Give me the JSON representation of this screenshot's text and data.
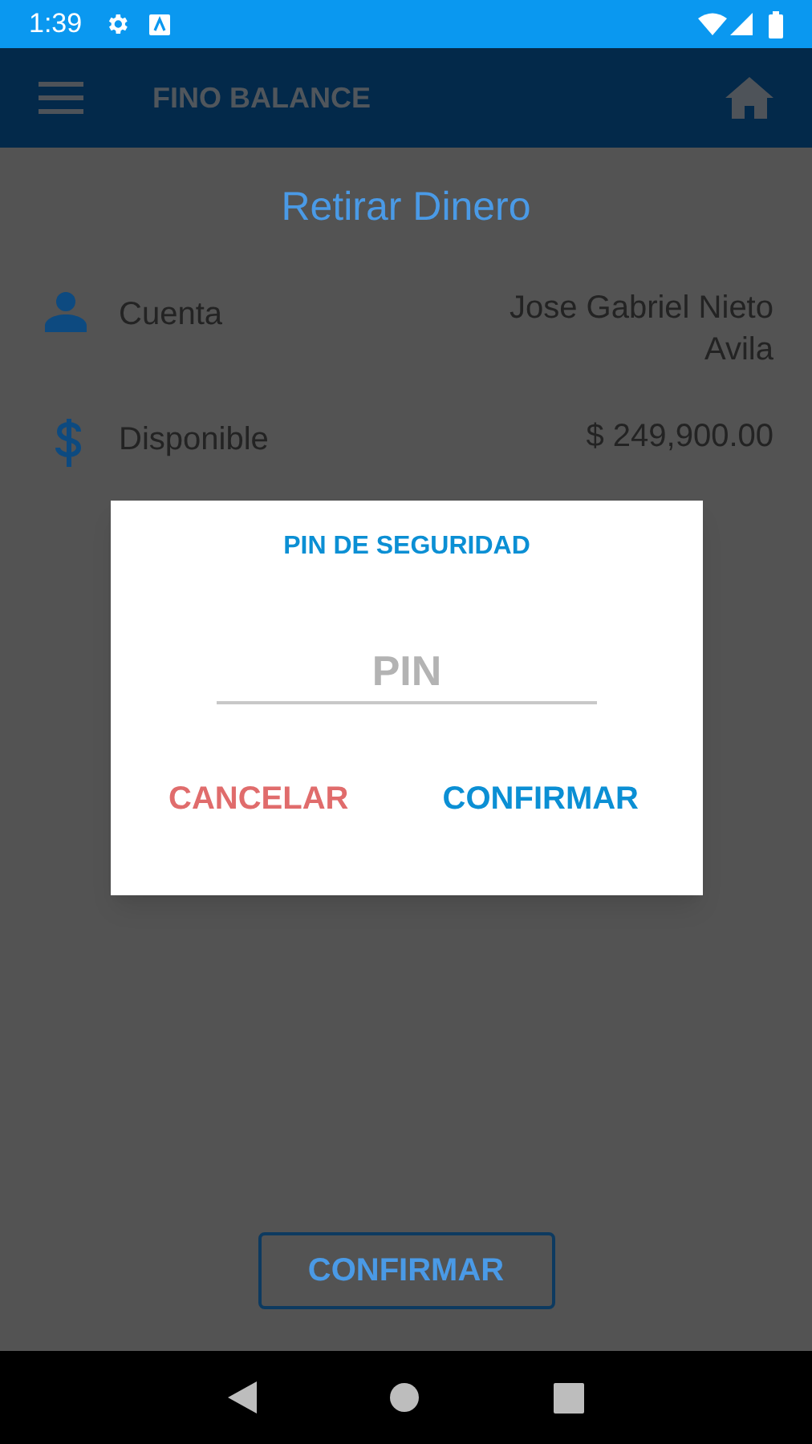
{
  "status_bar": {
    "time": "1:39"
  },
  "app_bar": {
    "title": "FINO BALANCE"
  },
  "page_title": "Retirar Dinero",
  "fields": [
    {
      "kind": "account",
      "label": "Cuenta",
      "value": "Jose Gabriel Nieto Avila"
    },
    {
      "kind": "balance",
      "label": "Disponible",
      "value": "$ 249,900.00"
    }
  ],
  "dialog": {
    "title": "PIN DE SEGURIDAD",
    "pin_field": {
      "placeholder": "PIN"
    },
    "buttons": [
      {
        "kind": "cancel",
        "label": "CANCELAR"
      },
      {
        "kind": "confirm",
        "label": "CONFIRMAR"
      }
    ]
  },
  "confirm_button": {
    "label": "CONFIRMAR"
  }
}
